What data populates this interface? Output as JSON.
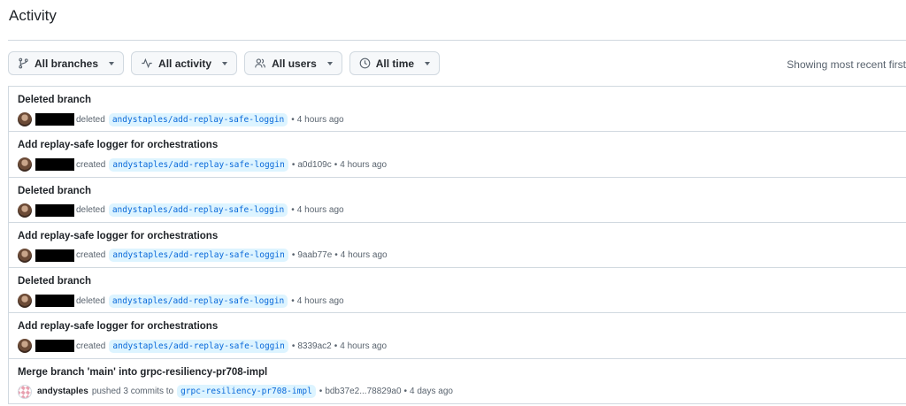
{
  "page": {
    "title": "Activity"
  },
  "filters": [
    {
      "label": "All branches",
      "icon": "branch-icon"
    },
    {
      "label": "All activity",
      "icon": "pulse-icon"
    },
    {
      "label": "All users",
      "icon": "people-icon"
    },
    {
      "label": "All time",
      "icon": "clock-icon"
    }
  ],
  "showing_text": "Showing most recent first",
  "menu_glyph": "...",
  "separator": "•",
  "rows": [
    {
      "title": "Deleted branch",
      "verb": "deleted",
      "branch": "andystaples/add-replay-safe-loggin",
      "commit": "",
      "time": "4 hours ago"
    },
    {
      "title": "Add replay-safe logger for orchestrations",
      "verb": "created",
      "branch": "andystaples/add-replay-safe-loggin",
      "commit": "a0d109c",
      "time": "4 hours ago"
    },
    {
      "title": "Deleted branch",
      "verb": "deleted",
      "branch": "andystaples/add-replay-safe-loggin",
      "commit": "",
      "time": "4 hours ago"
    },
    {
      "title": "Add replay-safe logger for orchestrations",
      "verb": "created",
      "branch": "andystaples/add-replay-safe-loggin",
      "commit": "9aab77e",
      "time": "4 hours ago"
    },
    {
      "title": "Deleted branch",
      "verb": "deleted",
      "branch": "andystaples/add-replay-safe-loggin",
      "commit": "",
      "time": "4 hours ago"
    },
    {
      "title": "Add replay-safe logger for orchestrations",
      "verb": "created",
      "branch": "andystaples/add-replay-safe-loggin",
      "commit": "8339ac2",
      "time": "4 hours ago"
    },
    {
      "title": "Merge branch 'main' into grpc-resiliency-pr708-impl",
      "actor": "andystaples",
      "verb": "pushed 3 commits to",
      "branch": "grpc-resiliency-pr708-impl",
      "commit": "bdb37e2...78829a0",
      "time": "4 days ago"
    }
  ],
  "colors": {
    "link": "#0969da",
    "pill_bg": "#ddf4ff",
    "border": "#d1d9e0",
    "muted": "#59636e"
  }
}
